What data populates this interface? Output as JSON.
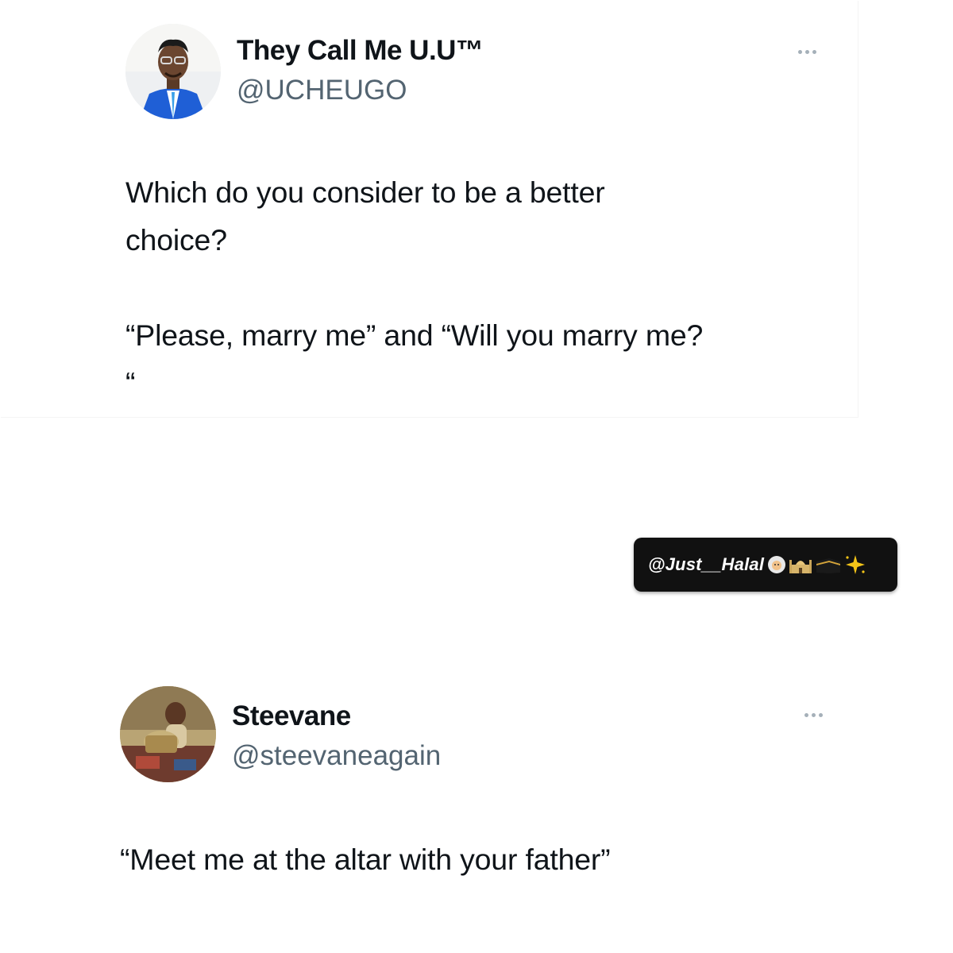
{
  "tweets": [
    {
      "display_name": "They Call Me U.U™",
      "handle": "@UCHEUGO",
      "text": "Which do you consider to be a better\nchoice?\n\n“Please, marry me” and “Will you marry me?\n“",
      "avatar_icon": "profile-photo",
      "more_icon": "ellipsis-icon"
    },
    {
      "display_name": "Steevane",
      "handle": "@steevaneagain",
      "text": "“Meet me at the altar with your father”",
      "avatar_icon": "profile-photo",
      "more_icon": "ellipsis-icon"
    }
  ],
  "watermark": {
    "text": "@Just__Halal",
    "icons": [
      "woman-with-headscarf-emoji",
      "mosque-emoji",
      "kaaba-emoji",
      "sparkle-emoji"
    ]
  },
  "colors": {
    "text_primary": "#0f1419",
    "text_secondary": "#536471",
    "more_dots": "#a5b0b9",
    "watermark_bg": "#111111",
    "watermark_text": "#ffffff"
  }
}
